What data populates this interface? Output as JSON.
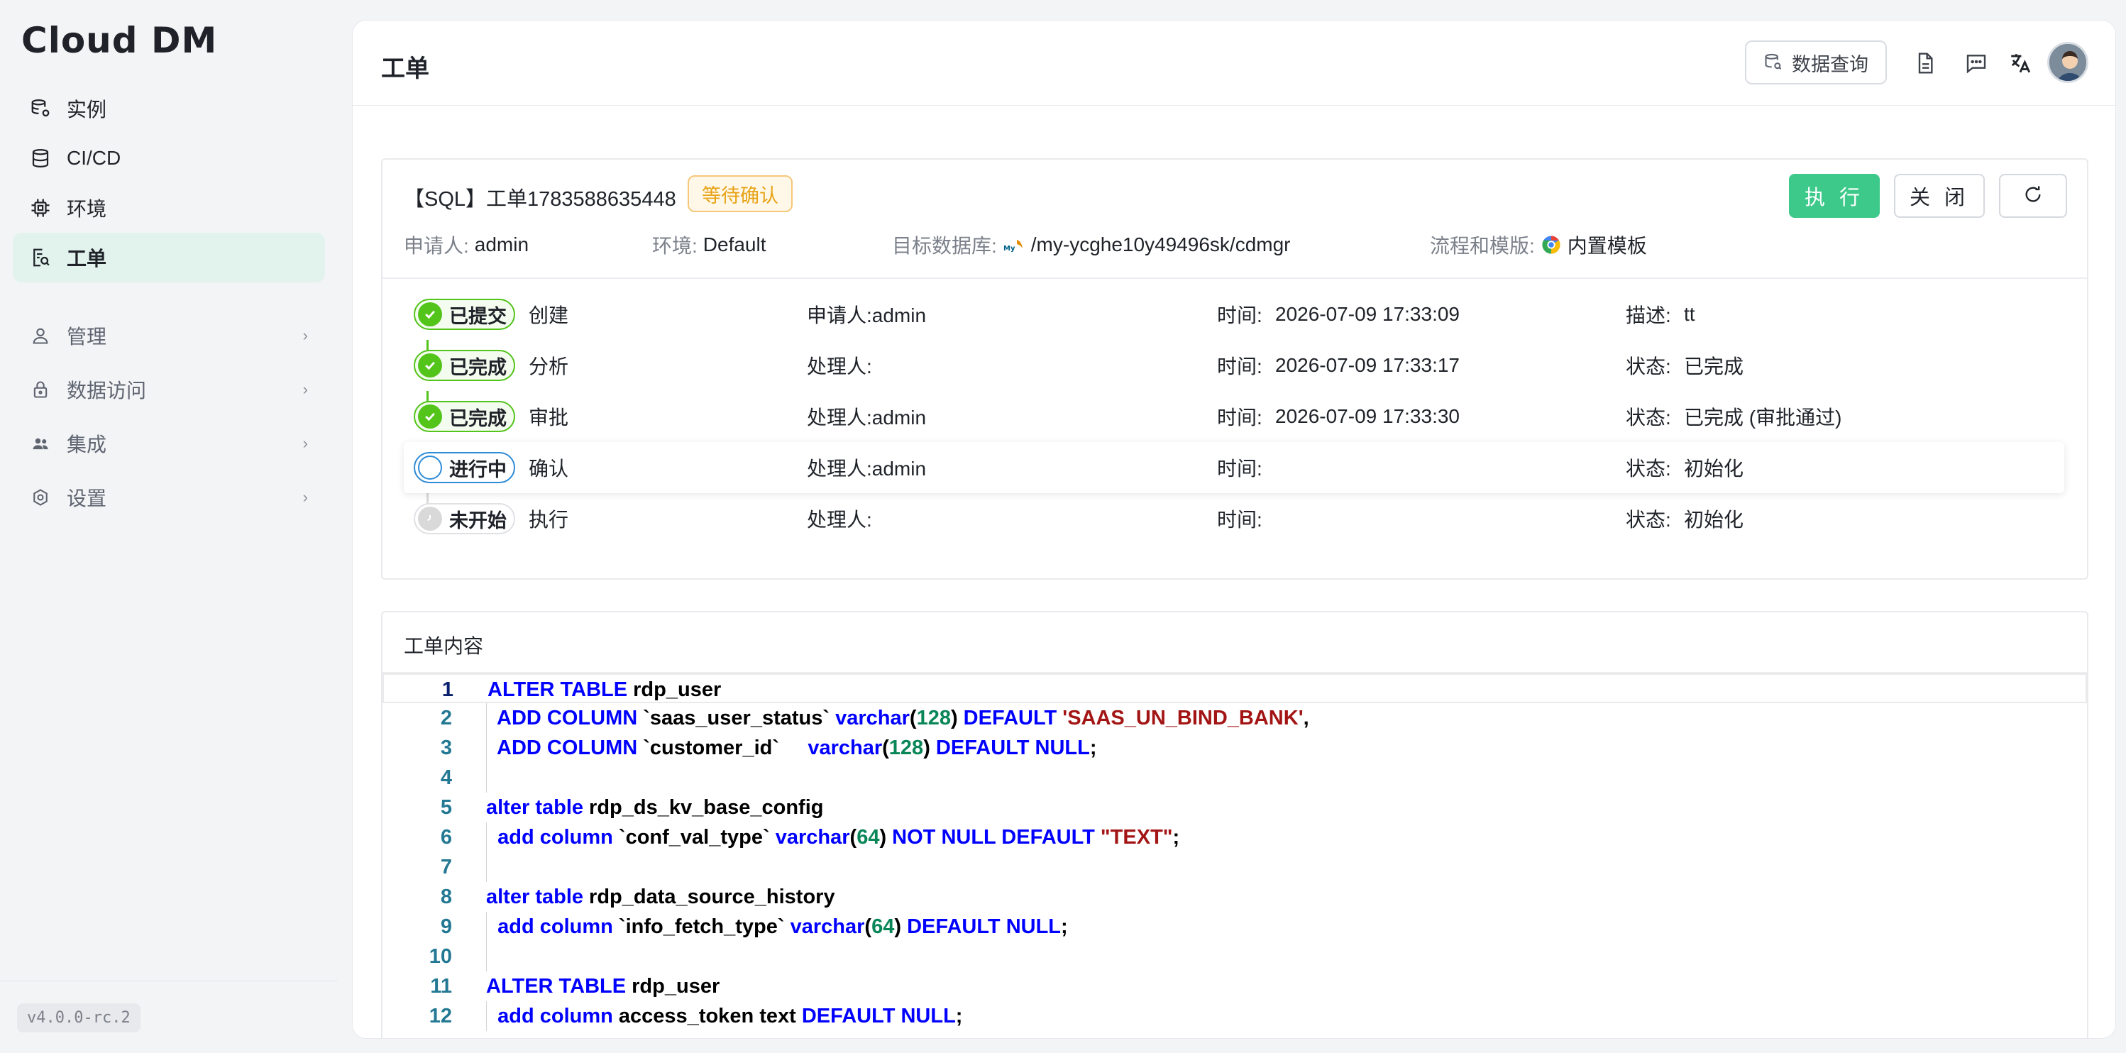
{
  "app": {
    "logo": "Cloud DM",
    "version": "v4.0.0-rc.2"
  },
  "sidebar": {
    "items": [
      {
        "label": "实例"
      },
      {
        "label": "CI/CD"
      },
      {
        "label": "环境"
      },
      {
        "label": "工单"
      }
    ],
    "groups": [
      {
        "label": "管理"
      },
      {
        "label": "数据访问"
      },
      {
        "label": "集成"
      },
      {
        "label": "设置"
      }
    ]
  },
  "header": {
    "title": "工单",
    "query_button": "数据查询"
  },
  "ticket": {
    "title": "【SQL】工单1783588635448",
    "status": "等待确认",
    "execute_label": "执 行",
    "close_label": "关 闭",
    "applicant_label": "申请人:",
    "applicant": "admin",
    "env_label": "环境:",
    "env": "Default",
    "target_db_label": "目标数据库:",
    "target_db": "/my-ycghe10y49496sk/cdmgr",
    "flow_label": "流程和模版:",
    "flow": "内置模板"
  },
  "steps": [
    {
      "status": "已提交",
      "name": "创建",
      "person": "申请人:admin",
      "time_label": "时间:",
      "time": "2026-07-09 17:33:09",
      "info_label": "描述:",
      "info": "tt"
    },
    {
      "status": "已完成",
      "name": "分析",
      "person": "处理人:",
      "time_label": "时间:",
      "time": "2026-07-09 17:33:17",
      "info_label": "状态:",
      "info": "已完成"
    },
    {
      "status": "已完成",
      "name": "审批",
      "person": "处理人:admin",
      "time_label": "时间:",
      "time": "2026-07-09 17:33:30",
      "info_label": "状态:",
      "info": "已完成 (审批通过)"
    },
    {
      "status": "进行中",
      "name": "确认",
      "person": "处理人:admin",
      "time_label": "时间:",
      "time": "",
      "info_label": "状态:",
      "info": "初始化"
    },
    {
      "status": "未开始",
      "name": "执行",
      "person": "处理人:",
      "time_label": "时间:",
      "time": "",
      "info_label": "状态:",
      "info": "初始化"
    }
  ],
  "content": {
    "title": "工单内容",
    "lines": [
      {
        "n": "1",
        "tokens": [
          [
            "kw",
            "ALTER TABLE"
          ],
          [
            "t",
            " rdp_user"
          ]
        ]
      },
      {
        "n": "2",
        "tokens": [
          [
            "t",
            "  "
          ],
          [
            "kw",
            "ADD COLUMN"
          ],
          [
            "t",
            " `saas_user_status` "
          ],
          [
            "kw",
            "varchar"
          ],
          [
            "t",
            "("
          ],
          [
            "num",
            "128"
          ],
          [
            "t",
            ") "
          ],
          [
            "kw",
            "DEFAULT"
          ],
          [
            "t",
            " "
          ],
          [
            "str",
            "'SAAS_UN_BIND_BANK'"
          ],
          [
            "t",
            ","
          ]
        ]
      },
      {
        "n": "3",
        "tokens": [
          [
            "t",
            "  "
          ],
          [
            "kw",
            "ADD COLUMN"
          ],
          [
            "t",
            " `customer_id`     "
          ],
          [
            "kw",
            "varchar"
          ],
          [
            "t",
            "("
          ],
          [
            "num",
            "128"
          ],
          [
            "t",
            ") "
          ],
          [
            "kw",
            "DEFAULT NULL"
          ],
          [
            "t",
            ";"
          ]
        ]
      },
      {
        "n": "4",
        "tokens": []
      },
      {
        "n": "5",
        "tokens": [
          [
            "kw",
            "alter table"
          ],
          [
            "t",
            " rdp_ds_kv_base_config"
          ]
        ]
      },
      {
        "n": "6",
        "tokens": [
          [
            "t",
            "  "
          ],
          [
            "kw",
            "add column"
          ],
          [
            "t",
            " `conf_val_type` "
          ],
          [
            "kw",
            "varchar"
          ],
          [
            "t",
            "("
          ],
          [
            "num",
            "64"
          ],
          [
            "t",
            ") "
          ],
          [
            "kw",
            "NOT NULL DEFAULT"
          ],
          [
            "t",
            " "
          ],
          [
            "str",
            "\"TEXT\""
          ],
          [
            "t",
            ";"
          ]
        ]
      },
      {
        "n": "7",
        "tokens": []
      },
      {
        "n": "8",
        "tokens": [
          [
            "kw",
            "alter table"
          ],
          [
            "t",
            " rdp_data_source_history"
          ]
        ]
      },
      {
        "n": "9",
        "tokens": [
          [
            "t",
            "  "
          ],
          [
            "kw",
            "add column"
          ],
          [
            "t",
            " `info_fetch_type` "
          ],
          [
            "kw",
            "varchar"
          ],
          [
            "t",
            "("
          ],
          [
            "num",
            "64"
          ],
          [
            "t",
            ") "
          ],
          [
            "kw",
            "DEFAULT NULL"
          ],
          [
            "t",
            ";"
          ]
        ]
      },
      {
        "n": "10",
        "tokens": []
      },
      {
        "n": "11",
        "tokens": [
          [
            "kw",
            "ALTER TABLE"
          ],
          [
            "t",
            " rdp_user"
          ]
        ]
      },
      {
        "n": "12",
        "tokens": [
          [
            "t",
            "  "
          ],
          [
            "kw",
            "add column"
          ],
          [
            "t",
            " access_token text "
          ],
          [
            "kw",
            "DEFAULT NULL"
          ],
          [
            "t",
            ";"
          ]
        ]
      }
    ]
  },
  "colors": {
    "accent": "#3dc98a",
    "done": "#52c41a",
    "doing": "#2e8bd6",
    "warning": "#e8a317"
  }
}
